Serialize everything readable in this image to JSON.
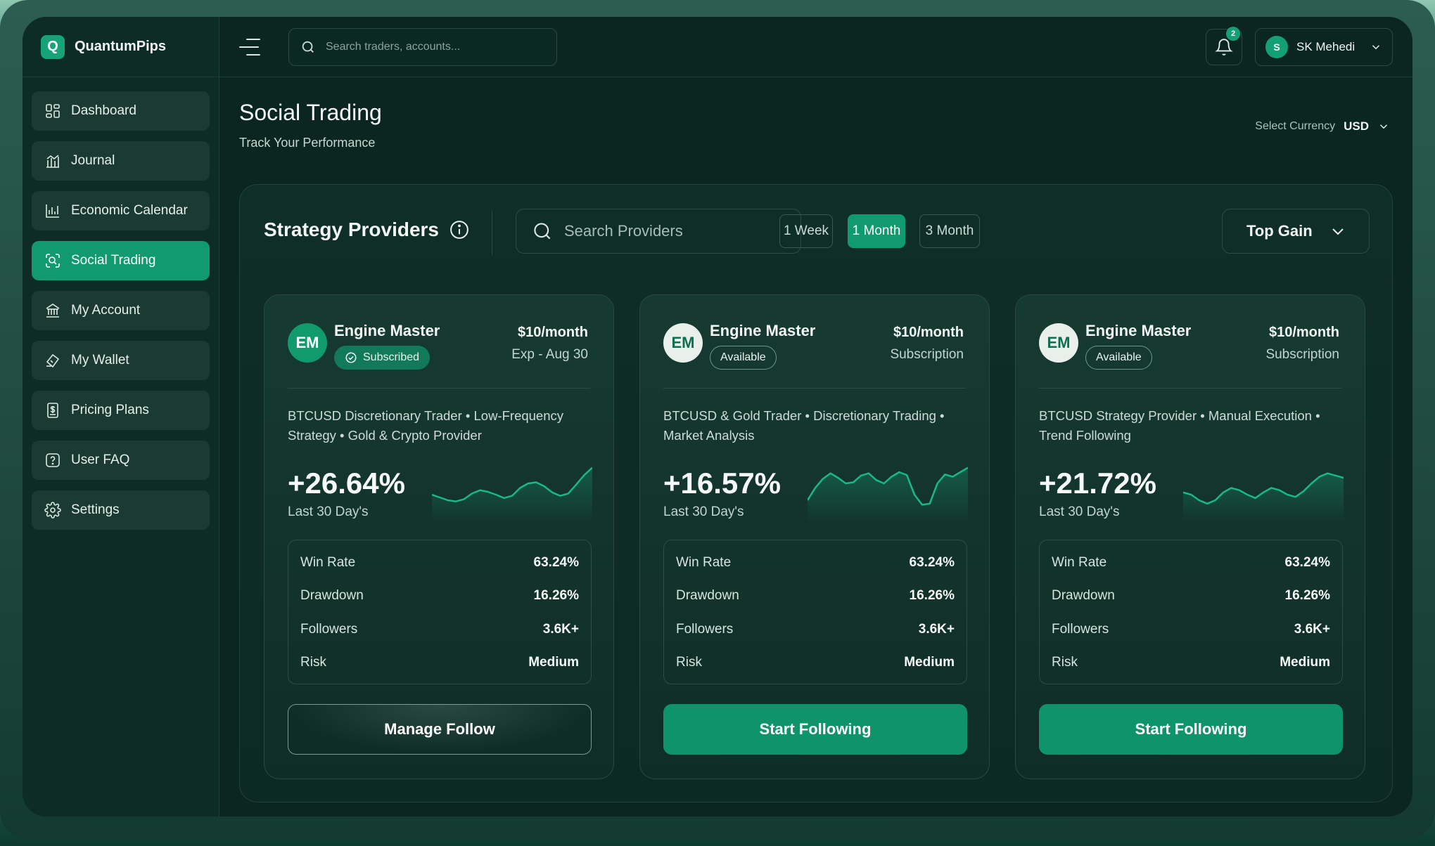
{
  "app": {
    "brand": "QuantumPips",
    "brand_initial": "Q",
    "accent": "#109a6e"
  },
  "sidebar": {
    "items": [
      {
        "label": "Dashboard",
        "icon": "grid-icon",
        "active": false
      },
      {
        "label": "Journal",
        "icon": "journal-chart-icon",
        "active": false
      },
      {
        "label": "Economic Calendar",
        "icon": "bar-chart-icon",
        "active": false
      },
      {
        "label": "Social Trading",
        "icon": "social-search-icon",
        "active": true
      },
      {
        "label": "My Account",
        "icon": "bank-icon",
        "active": false
      },
      {
        "label": "My Wallet",
        "icon": "wallet-icon",
        "active": false
      },
      {
        "label": "Pricing Plans",
        "icon": "receipt-icon",
        "active": false
      },
      {
        "label": "User FAQ",
        "icon": "help-icon",
        "active": false
      },
      {
        "label": "Settings",
        "icon": "gear-icon",
        "active": false
      }
    ]
  },
  "topbar": {
    "search_placeholder": "Search traders, accounts...",
    "notification_count": "2",
    "user_initial": "S",
    "user_name": "SK Mehedi"
  },
  "page": {
    "title": "Social Trading",
    "subtitle": "Track Your Performance",
    "currency_label": "Select Currency",
    "currency_value": "USD"
  },
  "panel": {
    "title": "Strategy Providers",
    "search_placeholder": "Search Providers",
    "periods": [
      "1 Week",
      "1 Month",
      "3 Month"
    ],
    "active_period": "1 Month",
    "sort_label": "Top Gain"
  },
  "cards": [
    {
      "initials": "EM",
      "name": "Engine Master",
      "status": "Subscribed",
      "price": "$10/month",
      "price_sub": "Exp - Aug 30",
      "description": "BTCUSD Discretionary Trader • Low-Frequency Strategy • Gold & Crypto Provider",
      "gain": "+26.64%",
      "period": "Last 30 Day's",
      "stats": [
        {
          "label": "Win Rate",
          "value": "63.24%"
        },
        {
          "label": "Drawdown",
          "value": "16.26%"
        },
        {
          "label": "Followers",
          "value": "3.6K+"
        },
        {
          "label": "Risk",
          "value": "Medium"
        }
      ],
      "button": "Manage Follow",
      "sparkline": [
        40,
        35,
        30,
        28,
        32,
        42,
        48,
        45,
        40,
        34,
        38,
        52,
        60,
        62,
        55,
        44,
        38,
        42,
        58,
        75,
        88
      ]
    },
    {
      "initials": "EM",
      "name": "Engine Master",
      "status": "Available",
      "price": "$10/month",
      "price_sub": "Subscription",
      "description": "BTCUSD & Gold Trader • Discretionary Trading • Market Analysis",
      "gain": "+16.57%",
      "period": "Last 30 Day's",
      "stats": [
        {
          "label": "Win Rate",
          "value": "63.24%"
        },
        {
          "label": "Drawdown",
          "value": "16.26%"
        },
        {
          "label": "Followers",
          "value": "3.6K+"
        },
        {
          "label": "Risk",
          "value": "Medium"
        }
      ],
      "button": "Start Following",
      "sparkline": [
        30,
        52,
        68,
        78,
        70,
        60,
        62,
        74,
        78,
        66,
        60,
        72,
        80,
        75,
        40,
        22,
        24,
        60,
        76,
        72,
        80,
        88
      ]
    },
    {
      "initials": "EM",
      "name": "Engine Master",
      "status": "Available",
      "price": "$10/month",
      "price_sub": "Subscription",
      "description": "BTCUSD Strategy Provider • Manual Execution • Trend Following",
      "gain": "+21.72%",
      "period": "Last 30 Day's",
      "stats": [
        {
          "label": "Win Rate",
          "value": "63.24%"
        },
        {
          "label": "Drawdown",
          "value": "16.26%"
        },
        {
          "label": "Followers",
          "value": "3.6K+"
        },
        {
          "label": "Risk",
          "value": "Medium"
        }
      ],
      "button": "Start Following",
      "sparkline": [
        44,
        40,
        30,
        24,
        30,
        44,
        52,
        48,
        40,
        34,
        44,
        52,
        48,
        40,
        36,
        46,
        60,
        72,
        78,
        74,
        70
      ]
    }
  ]
}
